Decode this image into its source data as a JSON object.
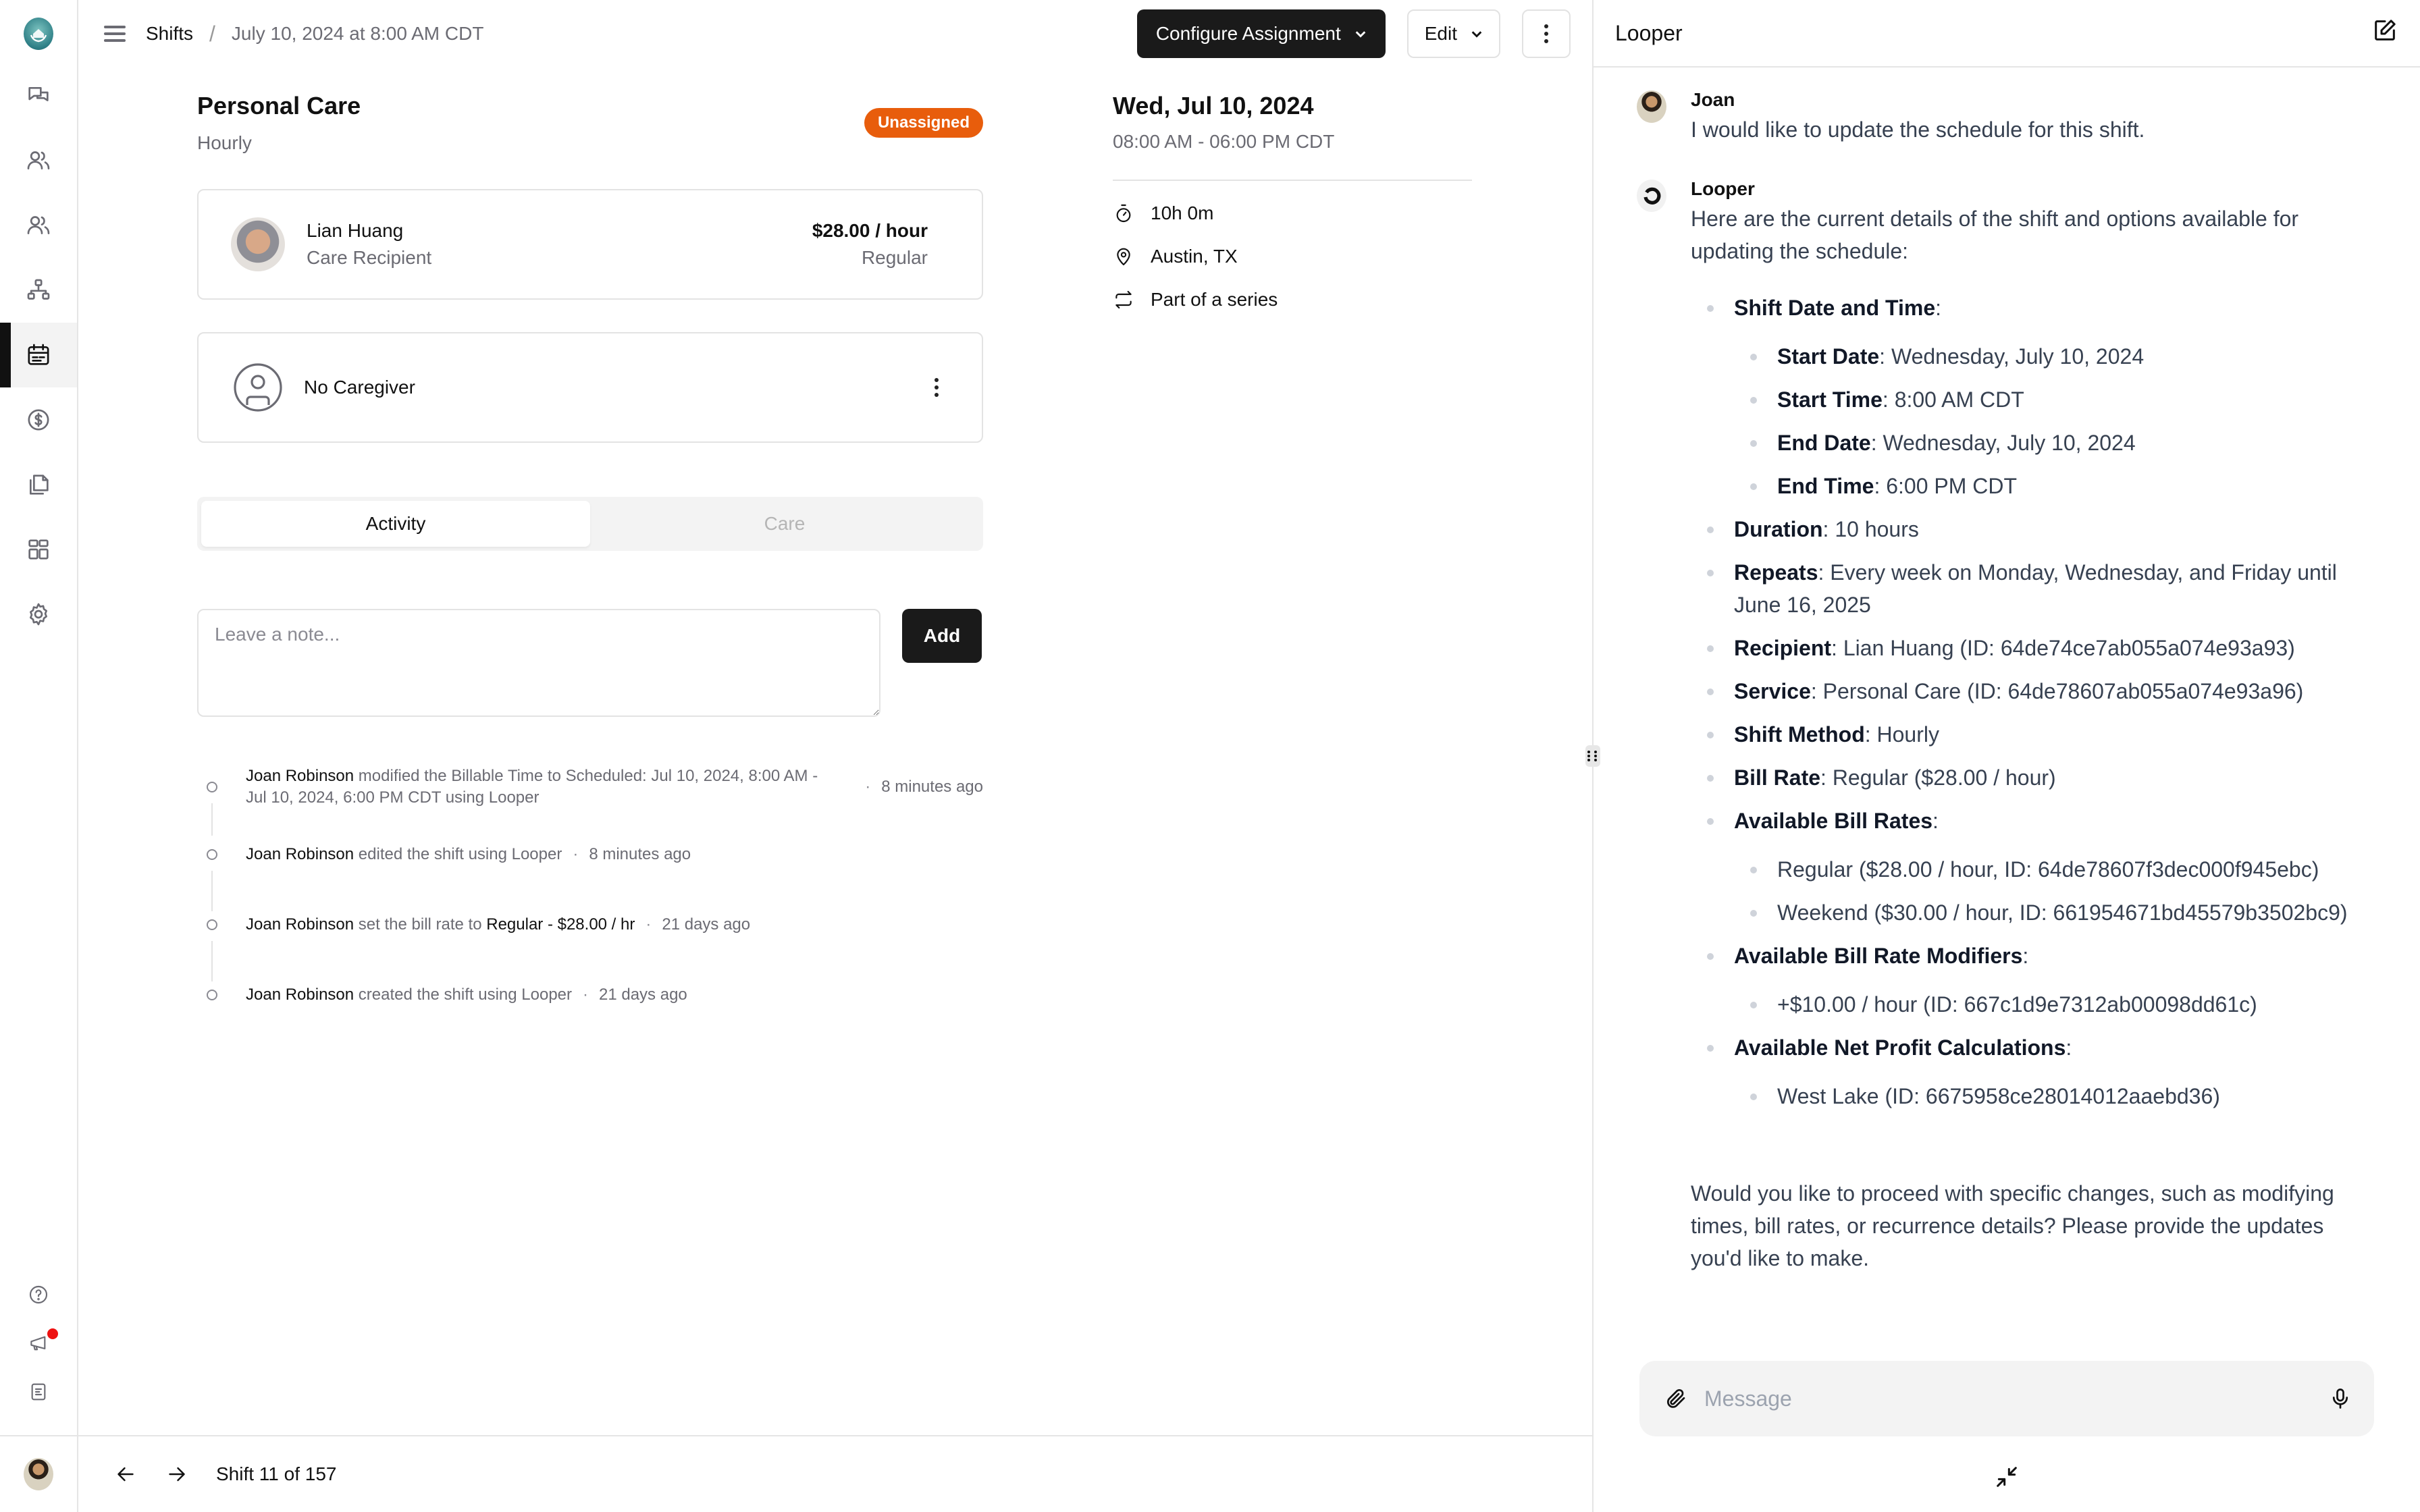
{
  "sidebar": {
    "logo": "home-care-hands-logo",
    "nav": [
      {
        "id": "messages",
        "icon": "chat-bubbles-icon",
        "active": false
      },
      {
        "id": "clients",
        "icon": "users-icon",
        "active": false
      },
      {
        "id": "caregivers",
        "icon": "users-icon",
        "active": false
      },
      {
        "id": "organization",
        "icon": "org-chart-icon",
        "active": false
      },
      {
        "id": "schedule",
        "icon": "calendar-icon",
        "active": true
      },
      {
        "id": "billing",
        "icon": "dollar-circle-icon",
        "active": false
      },
      {
        "id": "documents",
        "icon": "documents-icon",
        "active": false
      },
      {
        "id": "apps",
        "icon": "grid-icon",
        "active": false
      },
      {
        "id": "settings",
        "icon": "gear-icon",
        "active": false
      }
    ],
    "utility": [
      {
        "id": "help",
        "icon": "help-circle-icon"
      },
      {
        "id": "announcements",
        "icon": "megaphone-icon",
        "has_notification": true
      },
      {
        "id": "changelog",
        "icon": "document-lines-icon"
      }
    ]
  },
  "header": {
    "breadcrumb_root": "Shifts",
    "breadcrumb_separator": "/",
    "breadcrumb_current": "July 10, 2024 at 8:00 AM CDT",
    "configure_label": "Configure Assignment",
    "edit_label": "Edit"
  },
  "shift": {
    "service": "Personal Care",
    "method": "Hourly",
    "status": "Unassigned",
    "status_color": "#E85D0C",
    "recipient": {
      "name": "Lian Huang",
      "role": "Care Recipient",
      "rate": "$28.00 / hour",
      "rate_type": "Regular"
    },
    "caregiver": {
      "name": "No Caregiver"
    },
    "date_title": "Wed, Jul 10, 2024",
    "time_range": "08:00 AM - 06:00 PM CDT",
    "duration": "10h 0m",
    "location": "Austin, TX",
    "series": "Part of a series"
  },
  "tabs": [
    {
      "label": "Activity",
      "active": true
    },
    {
      "label": "Care",
      "active": false
    }
  ],
  "note": {
    "placeholder": "Leave a note...",
    "value": "",
    "add_label": "Add"
  },
  "activity": [
    {
      "actor": "Joan Robinson",
      "parts": [
        {
          "t": " modified the Billable Time to Scheduled: Jul 10, 2024, 8:00 AM - Jul 10, 2024, 6:00 PM CDT using Looper",
          "b": false
        }
      ],
      "time": "8 minutes ago"
    },
    {
      "actor": "Joan Robinson",
      "parts": [
        {
          "t": " edited the shift using Looper",
          "b": false
        }
      ],
      "time": "8 minutes ago"
    },
    {
      "actor": "Joan Robinson",
      "parts": [
        {
          "t": " set the bill rate to ",
          "b": false
        },
        {
          "t": "Regular - $28.00 / hr",
          "b": true
        }
      ],
      "time": "21 days ago"
    },
    {
      "actor": "Joan Robinson",
      "parts": [
        {
          "t": " created the shift using Looper",
          "b": false
        }
      ],
      "time": "21 days ago"
    }
  ],
  "footer": {
    "position_text": "Shift 11 of 157"
  },
  "chat": {
    "title": "Looper",
    "messages": [
      {
        "author": "Joan",
        "avatar": "joan",
        "text": "I would like to update the schedule for this shift."
      },
      {
        "author": "Looper",
        "avatar": "looper",
        "text": "Here are the current details of the shift and options available for updating the schedule:"
      }
    ],
    "details": [
      {
        "label": "Shift Date and Time",
        "value": "",
        "children": [
          {
            "label": "Start Date",
            "value": "Wednesday, July 10, 2024"
          },
          {
            "label": "Start Time",
            "value": "8:00 AM CDT"
          },
          {
            "label": "End Date",
            "value": "Wednesday, July 10, 2024"
          },
          {
            "label": "End Time",
            "value": "6:00 PM CDT"
          }
        ]
      },
      {
        "label": "Duration",
        "value": "10 hours"
      },
      {
        "label": "Repeats",
        "value": "Every week on Monday, Wednesday, and Friday until June 16, 2025"
      },
      {
        "label": "Recipient",
        "value": "Lian Huang (ID: 64de74ce7ab055a074e93a93)"
      },
      {
        "label": "Service",
        "value": "Personal Care (ID: 64de78607ab055a074e93a96)"
      },
      {
        "label": "Shift Method",
        "value": "Hourly"
      },
      {
        "label": "Bill Rate",
        "value": "Regular ($28.00 / hour)"
      },
      {
        "label": "Available Bill Rates",
        "value": "",
        "children": [
          {
            "label": "",
            "value": "Regular ($28.00 / hour, ID: 64de78607f3dec000f945ebc)"
          },
          {
            "label": "",
            "value": "Weekend ($30.00 / hour, ID: 661954671bd45579b3502bc9)"
          }
        ]
      },
      {
        "label": "Available Bill Rate Modifiers",
        "value": "",
        "children": [
          {
            "label": "",
            "value": "+$10.00 / hour (ID: 667c1d9e7312ab00098dd61c)"
          }
        ]
      },
      {
        "label": "Available Net Profit Calculations",
        "value": "",
        "children": [
          {
            "label": "",
            "value": "West Lake (ID: 6675958ce28014012aaebd36)"
          }
        ]
      }
    ],
    "closing": "Would you like to proceed with specific changes, such as modifying times, bill rates, or recurrence details? Please provide the updates you'd like to make.",
    "input_placeholder": "Message",
    "input_value": ""
  }
}
